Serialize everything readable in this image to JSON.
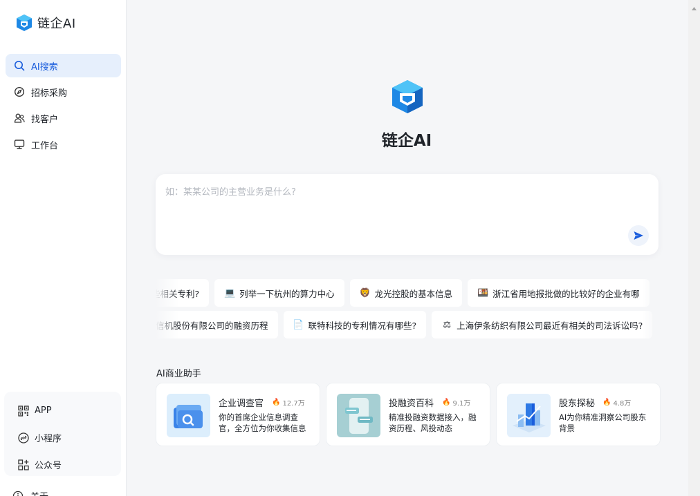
{
  "brand": {
    "name": "链企AI"
  },
  "nav": {
    "items": [
      {
        "label": "AI搜索",
        "icon": "search-icon",
        "active": true
      },
      {
        "label": "招标采购",
        "icon": "compass-icon",
        "active": false
      },
      {
        "label": "找客户",
        "icon": "users-icon",
        "active": false
      },
      {
        "label": "工作台",
        "icon": "monitor-icon",
        "active": false
      }
    ]
  },
  "bottom": {
    "items": [
      {
        "label": "APP",
        "icon": "qrcode-icon"
      },
      {
        "label": "小程序",
        "icon": "mini-program-icon"
      },
      {
        "label": "公众号",
        "icon": "grid-icon"
      }
    ],
    "about": "关于"
  },
  "hero": {
    "title": "链企AI"
  },
  "search": {
    "placeholder": "如：某某公司的主营业务是什么?"
  },
  "chips": {
    "row1": [
      {
        "text": "些相关专利?",
        "icon": ""
      },
      {
        "text": "列举一下杭州的算力中心",
        "icon": "💻"
      },
      {
        "text": "龙光控股的基本信息",
        "icon": "🦁"
      },
      {
        "text": "浙江省用地报批做的比较好的企业有哪",
        "icon": "🍱"
      }
    ],
    "row2": [
      {
        "text": "信机股份有限公司的融资历程",
        "icon": ""
      },
      {
        "text": "联特科技的专利情况有哪些?",
        "icon": "📄"
      },
      {
        "text": "上海伊条纺织有限公司最近有相关的司法诉讼吗?",
        "icon": "⚖"
      }
    ]
  },
  "assistants": {
    "title": "AI商业助手",
    "cards": [
      {
        "title": "企业调查官",
        "hot": "12.7万",
        "desc": "你的首席企业信息调查官，全方位为你收集信息"
      },
      {
        "title": "投融资百科",
        "hot": "9.1万",
        "desc": "精准投融资数据接入，融资历程、风投动态"
      },
      {
        "title": "股东探秘",
        "hot": "4.8万",
        "desc": "AI为你精准洞察公司股东背景"
      }
    ]
  },
  "colors": {
    "accent": "#1a5ddc",
    "active_bg": "#e6effc",
    "logo_blue": "#1e88e5"
  }
}
